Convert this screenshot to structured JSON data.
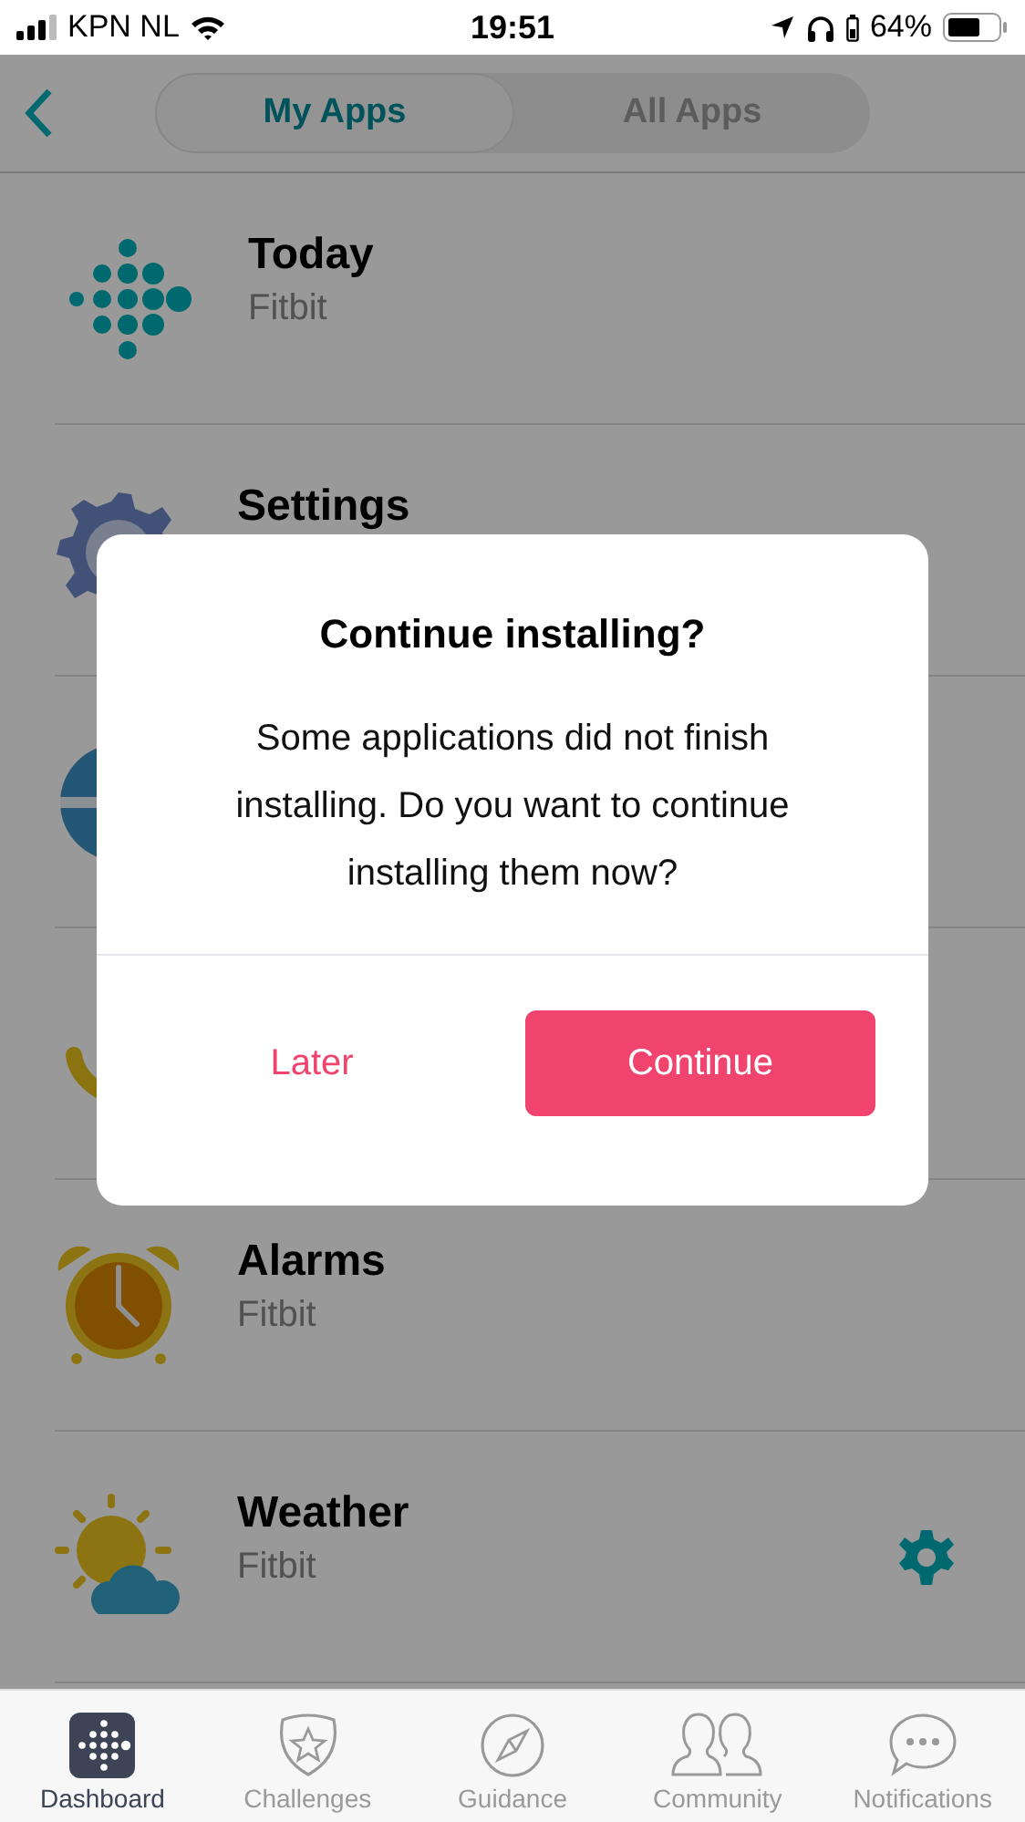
{
  "status_bar": {
    "carrier": "KPN NL",
    "time": "19:51",
    "battery": "64%"
  },
  "nav": {
    "tabs": [
      {
        "label": "My Apps",
        "selected": true
      },
      {
        "label": "All Apps",
        "selected": false
      }
    ]
  },
  "apps": [
    {
      "name": "Today",
      "developer": "Fitbit",
      "settings_button": false
    },
    {
      "name": "Settings",
      "settings_button": false
    },
    {
      "settings_button": false
    },
    {
      "settings_button": false
    },
    {
      "name": "Alarms",
      "developer": "Fitbit",
      "settings_button": false
    },
    {
      "name": "Weather",
      "developer": "Fitbit",
      "settings_button": true
    }
  ],
  "dialog": {
    "title": "Continue installing?",
    "message": "Some applications did not finish installing. Do you want to continue installing them now?",
    "buttons": [
      {
        "label": "Later",
        "kind": "text"
      },
      {
        "label": "Continue",
        "kind": "primary"
      }
    ]
  },
  "tab_bar": [
    {
      "label": "Dashboard",
      "selected": true
    },
    {
      "label": "Challenges",
      "selected": false
    },
    {
      "label": "Guidance",
      "selected": false
    },
    {
      "label": "Community",
      "selected": false
    },
    {
      "label": "Notifications",
      "selected": false
    }
  ]
}
